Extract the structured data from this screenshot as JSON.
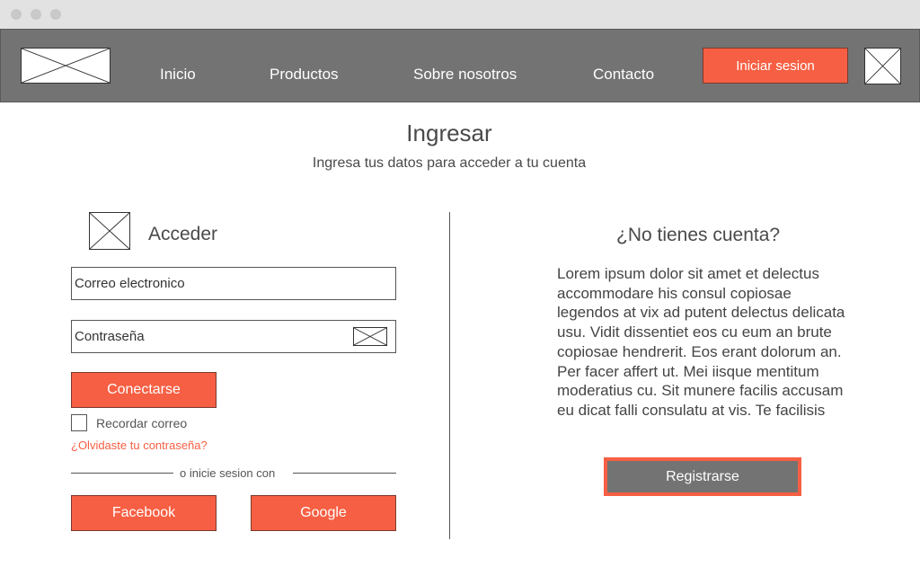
{
  "nav": {
    "links": [
      "Inicio",
      "Productos",
      "Sobre nosotros",
      "Contacto"
    ],
    "login_button": "Iniciar sesion"
  },
  "page": {
    "title": "Ingresar",
    "subtitle": "Ingresa tus datos para acceder a tu cuenta"
  },
  "login": {
    "heading": "Acceder",
    "email_placeholder": "Correo electronico",
    "password_placeholder": "Contraseña",
    "submit_label": "Conectarse",
    "remember_label": "Recordar correo",
    "forgot_link": "¿Olvidaste tu contraseña?",
    "separator_text": "o inicie sesion con",
    "facebook_label": "Facebook",
    "google_label": "Google"
  },
  "register": {
    "heading": "¿No tienes cuenta?",
    "body": "Lorem ipsum dolor sit amet et delectus accommodare his consul copiosae legendos at vix ad putent delectus delicata usu. Vidit dissentiet eos cu eum an brute copiosae hendrerit. Eos erant dolorum an. Per facer affert ut. Mei iisque mentitum moderatius cu. Sit munere facilis accusam eu dicat falli consulatu at vis. Te facilisis",
    "button_label": "Registrarse"
  },
  "colors": {
    "accent": "#f65f43",
    "navbar": "#737373",
    "titlebar": "#e2e2e2"
  },
  "icons": {
    "logo": "image-placeholder-icon",
    "user": "image-placeholder-icon",
    "login_section": "image-placeholder-icon",
    "password_toggle": "envelope-icon"
  }
}
